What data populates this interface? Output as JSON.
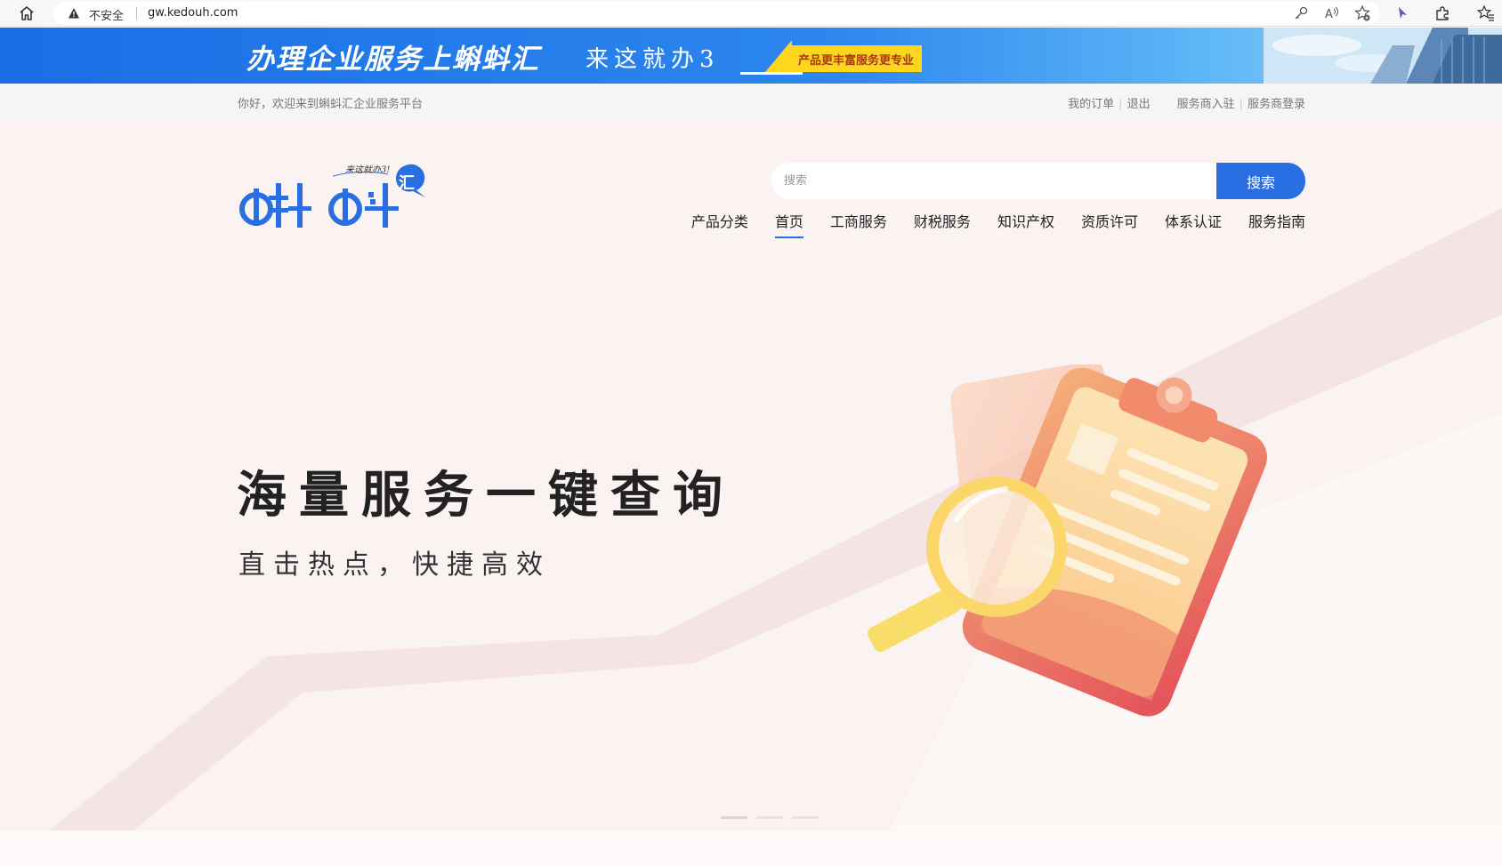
{
  "browser": {
    "insecure_label": "不安全",
    "url": "gw.kedouh.com",
    "icons": [
      "home-icon",
      "warning-icon",
      "key-icon",
      "read-aloud-icon",
      "favorite-add-icon",
      "copilot-icon",
      "extensions-icon",
      "favorites-icon"
    ]
  },
  "promo": {
    "main_text": "办理企业服务上蝌蚪汇",
    "sub_text": "来这就办3",
    "tag_text": "产品更丰富服务更专业",
    "colors": {
      "bg_start": "#1a6ee6",
      "bg_end": "#a9d6f4",
      "tag": "#ffd61e"
    }
  },
  "top_bar": {
    "welcome": "你好，欢迎来到蝌蚪汇企业服务平台",
    "my_orders": "我的订单",
    "logout": "退出",
    "provider_join": "服务商入驻",
    "provider_login": "服务商登录"
  },
  "logo": {
    "name": "蝌蚪汇",
    "slogan": "来这就办3!",
    "color": "#2a6ee4"
  },
  "search": {
    "placeholder": "搜索",
    "button": "搜索"
  },
  "nav": {
    "items": [
      {
        "label": "产品分类",
        "active": false
      },
      {
        "label": "首页",
        "active": true
      },
      {
        "label": "工商服务",
        "active": false
      },
      {
        "label": "财税服务",
        "active": false
      },
      {
        "label": "知识产权",
        "active": false
      },
      {
        "label": "资质许可",
        "active": false
      },
      {
        "label": "体系认证",
        "active": false
      },
      {
        "label": "服务指南",
        "active": false
      }
    ]
  },
  "hero": {
    "title": "海量服务一键查询",
    "subtitle": "直击热点，快捷高效",
    "illustration": "clipboard-magnifier-illustration",
    "carousel_total": 3,
    "carousel_active": 1
  },
  "colors": {
    "accent": "#2a6ee4",
    "hero_bg": "#fbf3f2",
    "text_dark": "#222222"
  }
}
